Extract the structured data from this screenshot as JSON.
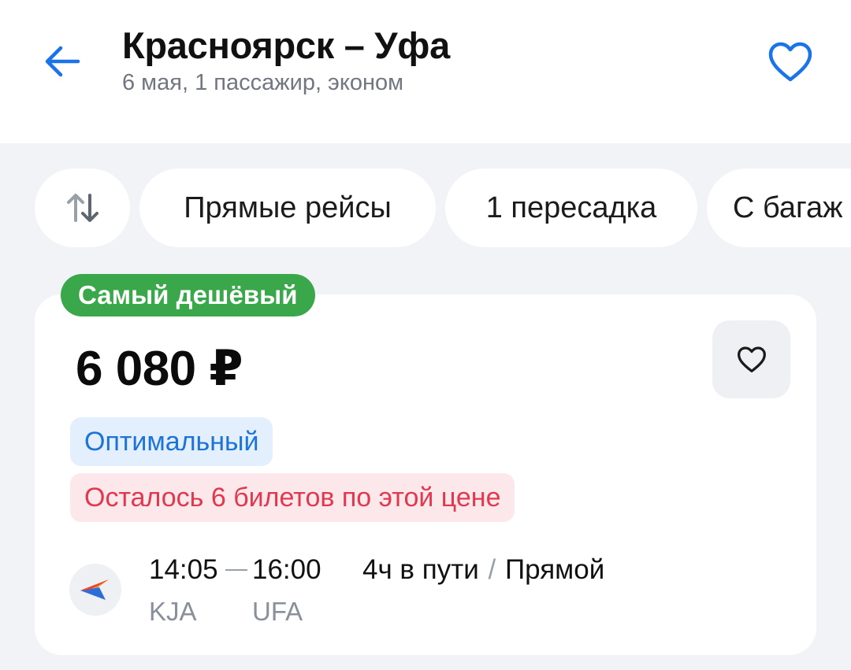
{
  "header": {
    "title": "Красноярск – Уфа",
    "subtitle": "6 мая, 1 пассажир, эконом",
    "back_icon": "arrow-left-icon",
    "favorite_icon": "heart-outline-icon"
  },
  "filters": {
    "sort_icon": "sort-arrows-icon",
    "chips": [
      "Прямые рейсы",
      "1 пересадка",
      "С багаж"
    ]
  },
  "ticket": {
    "badge": "Самый дешёвый",
    "price": "6 080 ₽",
    "tags": {
      "optimal": "Оптимальный",
      "seats_left": "Осталось 6 билетов по этой цене"
    },
    "flight": {
      "departure_time": "14:05",
      "arrival_time": "16:00",
      "departure_code": "KJA",
      "arrival_code": "UFA",
      "duration": "4ч в пути",
      "separator": "/",
      "type": "Прямой"
    },
    "airline_icon": "airline-logo-icon"
  },
  "colors": {
    "accent_blue": "#1c73d8",
    "badge_green": "#3aa84a",
    "alert_red": "#e0394f",
    "background": "#f1f3f6"
  }
}
